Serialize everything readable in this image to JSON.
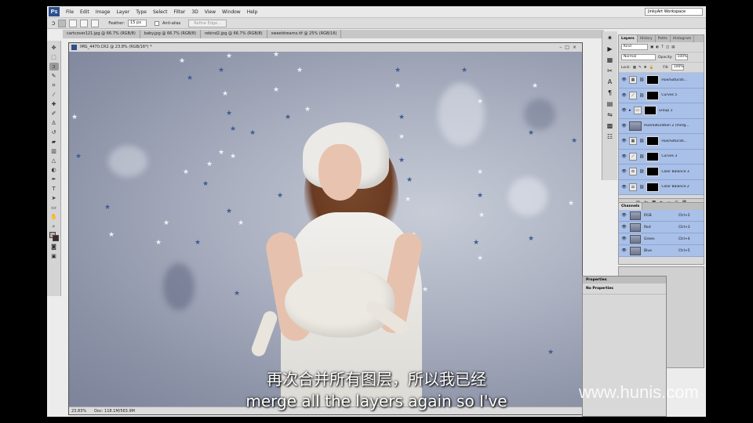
{
  "app": {
    "logo": "Ps",
    "workspace": "JinkyArt Workspace"
  },
  "menu": [
    "File",
    "Edit",
    "Image",
    "Layer",
    "Type",
    "Select",
    "Filter",
    "3D",
    "View",
    "Window",
    "Help"
  ],
  "window_controls": [
    "–",
    "□",
    "×"
  ],
  "options": {
    "feather_label": "Feather:",
    "feather_value": "15 px",
    "antialias_label": "Anti-alias",
    "refine_edge": "Refine Edge..."
  },
  "doc_tabs": [
    "cartcover121.jpg @ 66.7% (RGB/8)",
    "baby.jpg @ 66.7% (RGB/8)",
    "rebind2.jpg @ 66.7% (RGB/8)",
    "sweetdreams.tif @ 25% (RGB/16)"
  ],
  "image_window": {
    "title": "IMG_4470.CR2 @ 23.8% (RGB/16*) *",
    "zoom": "23.83%",
    "doc": "Doc: 118.1M/563.9M"
  },
  "layers_panel": {
    "tabs": [
      "Layers",
      "History",
      "Paths",
      "Histogram"
    ],
    "kind": "Kind",
    "blend_mode": "Normal",
    "opacity_label": "Opacity:",
    "opacity": "100%",
    "lock_label": "Lock:",
    "fill_label": "Fill:",
    "fill": "100%",
    "layers": [
      {
        "name": "Hue/Saturati...",
        "type": "adjust"
      },
      {
        "name": "Curves 5",
        "type": "curves"
      },
      {
        "name": "Group 1",
        "type": "group"
      },
      {
        "name": "Hue/Saturation 2 (merg...",
        "type": "pixel"
      },
      {
        "name": "Hue/Saturati...",
        "type": "adjust"
      },
      {
        "name": "Curves 3",
        "type": "curves"
      },
      {
        "name": "Color Balance 3",
        "type": "balance"
      },
      {
        "name": "Color Balance 2",
        "type": "balance"
      }
    ]
  },
  "channels_panel": {
    "title": "Channels",
    "channels": [
      {
        "name": "RGB",
        "shortcut": "Ctrl+2"
      },
      {
        "name": "Red",
        "shortcut": "Ctrl+3"
      },
      {
        "name": "Green",
        "shortcut": "Ctrl+4"
      },
      {
        "name": "Blue",
        "shortcut": "Ctrl+5"
      }
    ]
  },
  "properties_panel": {
    "title": "Properties",
    "body": "No Properties"
  },
  "subtitles": {
    "zh": "再次合并所有图层，所以我已经",
    "en": "merge all the layers again so I've"
  },
  "watermark": "www.hunis.com"
}
